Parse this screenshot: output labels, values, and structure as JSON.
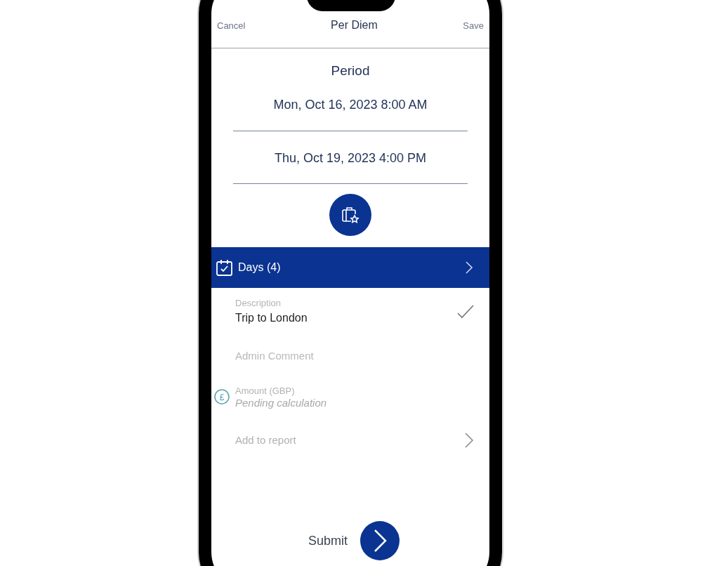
{
  "nav_bar": {
    "cancel": "Cancel",
    "title": "Per Diem",
    "save": "Save"
  },
  "period": {
    "title": "Period",
    "start": "Mon, Oct 16, 2023 8:00 AM",
    "end": "Thu, Oct 19, 2023 4:00 PM"
  },
  "days_bar": {
    "label": "Days (4)"
  },
  "fields": [
    {
      "kind": "text",
      "label": "Description",
      "value": "Trip to London"
    },
    {
      "kind": "comment",
      "placeholder": "Admin Comment"
    },
    {
      "kind": "amount",
      "symbol": "£",
      "label": "Amount (GBP)",
      "placeholder": "Pending calculation"
    },
    {
      "kind": "link",
      "label": "Add to report"
    }
  ],
  "submit": {
    "label": "Submit"
  }
}
